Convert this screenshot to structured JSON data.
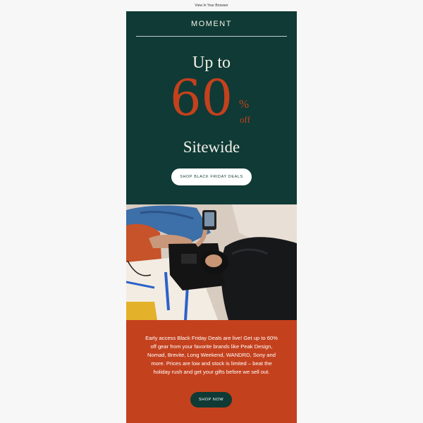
{
  "topbar": {
    "view_in_browser": "View In Your Browser"
  },
  "hero": {
    "brand": "MOMENT",
    "up_to": "Up to",
    "discount_number": "60",
    "percent_sign": "%",
    "off_label": "off",
    "sitewide": "Sitewide",
    "cta_label": "SHOP BLACK FRIDAY DEALS"
  },
  "photo": {
    "icon": "lifestyle-photo"
  },
  "promo": {
    "body": "Early access Black Friday Deals are live! Get up to 60% off gear from your favorite brands like Peak Design, Nomad, Brevite, Long Weekend, WANDRD, Sony and more. Prices are low and stock is limited – beat the holiday rush and get your gifts before we sell out.",
    "cta_label": "SHOP NOW"
  },
  "colors": {
    "hero_bg": "#0f3a35",
    "accent_orange": "#c4411d",
    "cream_text": "#f3f0e6"
  }
}
